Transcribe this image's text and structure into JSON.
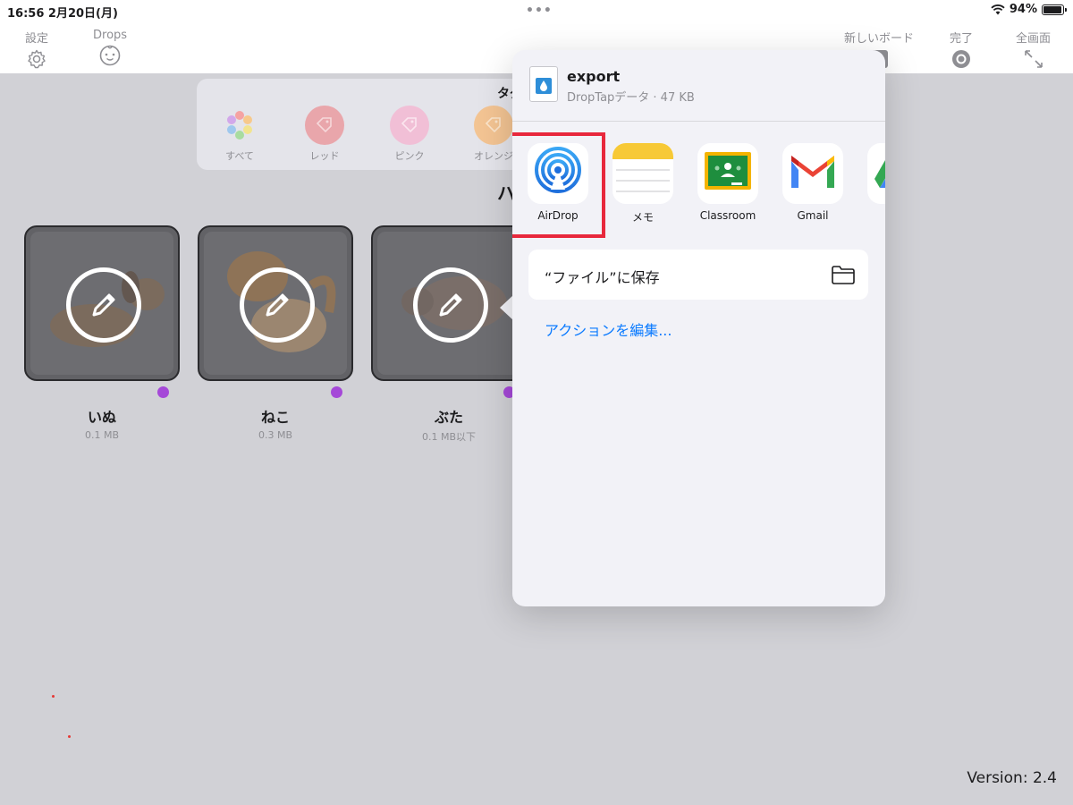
{
  "status_bar": {
    "time": "16:56",
    "date": "2月20日(月)",
    "dots": "•••",
    "battery_percent": "94%",
    "battery_level": 0.94
  },
  "toolbar": {
    "settings_label": "設定",
    "drops_label": "Drops",
    "new_board_label": "新しいボード",
    "done_label": "完了",
    "fullscreen_label": "全画面"
  },
  "tags": {
    "heading_partial": "タグ",
    "items": [
      {
        "label": "すべて",
        "color": "#ffffff"
      },
      {
        "label": "レッド",
        "color": "#e9a6ab"
      },
      {
        "label": "ピンク",
        "color": "#f1bfd6"
      },
      {
        "label": "オレンジ",
        "color": "#f3c493"
      }
    ]
  },
  "section_title_partial": "ハ",
  "cards": [
    {
      "name": "いぬ",
      "size": "0.1 MB"
    },
    {
      "name": "ねこ",
      "size": "0.3 MB"
    },
    {
      "name": "ぶた",
      "size": "0.1 MB以下"
    }
  ],
  "version": "Version: 2.4",
  "share_sheet": {
    "file_name": "export",
    "file_subtitle": "DropTapデータ · 47 KB",
    "apps": [
      {
        "label": "AirDrop",
        "icon": "airdrop-icon"
      },
      {
        "label": "メモ",
        "icon": "notes-icon"
      },
      {
        "label": "Classroom",
        "icon": "classroom-icon"
      },
      {
        "label": "Gmail",
        "icon": "gmail-icon"
      },
      {
        "label": "ド",
        "icon": "google-drive-icon"
      }
    ],
    "save_to_files": "“ファイル”に保存",
    "edit_actions": "アクションを編集...",
    "highlight_color": "#e8283c",
    "link_color": "#0a7aff"
  }
}
